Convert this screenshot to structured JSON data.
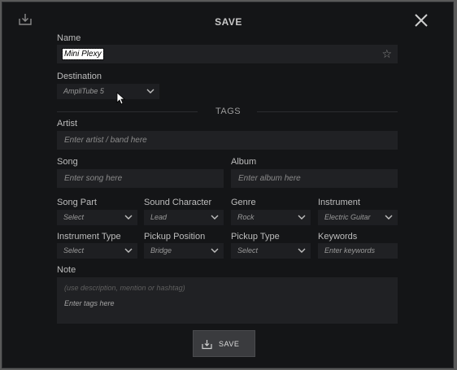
{
  "dialog": {
    "title": "SAVE"
  },
  "fields": {
    "name": {
      "label": "Name",
      "value": "Mini Plexy"
    },
    "destination": {
      "label": "Destination",
      "value": "AmpliTube 5"
    },
    "tags_heading": "TAGS",
    "artist": {
      "label": "Artist",
      "placeholder": "Enter artist / band here"
    },
    "song": {
      "label": "Song",
      "placeholder": "Enter song here"
    },
    "album": {
      "label": "Album",
      "placeholder": "Enter album here"
    },
    "song_part": {
      "label": "Song Part",
      "value": "Select"
    },
    "sound_character": {
      "label": "Sound Character",
      "value": "Lead"
    },
    "genre": {
      "label": "Genre",
      "value": "Rock"
    },
    "instrument": {
      "label": "Instrument",
      "value": "Electric Guitar"
    },
    "instrument_type": {
      "label": "Instrument Type",
      "value": "Select"
    },
    "pickup_position": {
      "label": "Pickup Position",
      "value": "Bridge"
    },
    "pickup_type": {
      "label": "Pickup Type",
      "value": "Select"
    },
    "keywords": {
      "label": "Keywords",
      "placeholder": "Enter keywords"
    },
    "note": {
      "label": "Note",
      "placeholder": "(use description, mention or hashtag)",
      "tags_placeholder": "Enter tags here"
    }
  },
  "buttons": {
    "save_label": "SAVE"
  },
  "icons": {
    "download": "download-icon",
    "close": "close-icon",
    "star": "star-icon",
    "chevron": "chevron-down-icon"
  }
}
